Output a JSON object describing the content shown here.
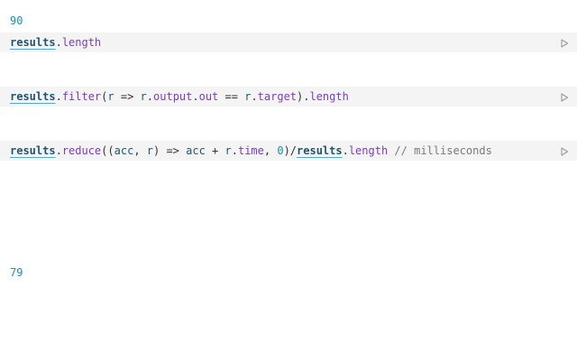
{
  "outputs": {
    "first": "90",
    "second": "79"
  },
  "cells": [
    {
      "tokens": [
        {
          "text": "results",
          "style": "var"
        },
        {
          "text": ".",
          "style": "plain"
        },
        {
          "text": "length",
          "style": "prop"
        }
      ]
    },
    {
      "tokens": [
        {
          "text": "results",
          "style": "var"
        },
        {
          "text": ".",
          "style": "plain"
        },
        {
          "text": "filter",
          "style": "prop"
        },
        {
          "text": "(",
          "style": "plain"
        },
        {
          "text": "r",
          "style": "param"
        },
        {
          "text": " => ",
          "style": "plain"
        },
        {
          "text": "r",
          "style": "param"
        },
        {
          "text": ".",
          "style": "plain"
        },
        {
          "text": "output",
          "style": "prop"
        },
        {
          "text": ".",
          "style": "plain"
        },
        {
          "text": "out",
          "style": "prop"
        },
        {
          "text": " == ",
          "style": "plain"
        },
        {
          "text": "r",
          "style": "param"
        },
        {
          "text": ".",
          "style": "plain"
        },
        {
          "text": "target",
          "style": "prop"
        },
        {
          "text": ").",
          "style": "plain"
        },
        {
          "text": "length",
          "style": "prop"
        }
      ]
    },
    {
      "tokens": [
        {
          "text": "results",
          "style": "var"
        },
        {
          "text": ".",
          "style": "plain"
        },
        {
          "text": "reduce",
          "style": "prop"
        },
        {
          "text": "((",
          "style": "plain"
        },
        {
          "text": "acc",
          "style": "param"
        },
        {
          "text": ", ",
          "style": "plain"
        },
        {
          "text": "r",
          "style": "param"
        },
        {
          "text": ") => ",
          "style": "plain"
        },
        {
          "text": "acc",
          "style": "param"
        },
        {
          "text": " + ",
          "style": "plain"
        },
        {
          "text": "r",
          "style": "param"
        },
        {
          "text": ".",
          "style": "plain"
        },
        {
          "text": "time",
          "style": "prop"
        },
        {
          "text": ", ",
          "style": "plain"
        },
        {
          "text": "0",
          "style": "num"
        },
        {
          "text": ")/",
          "style": "plain"
        },
        {
          "text": "results",
          "style": "var"
        },
        {
          "text": ".",
          "style": "plain"
        },
        {
          "text": "length",
          "style": "prop"
        },
        {
          "text": " ",
          "style": "plain"
        },
        {
          "text": "// milliseconds",
          "style": "comment"
        }
      ]
    }
  ],
  "icons": {
    "run": "play-icon"
  },
  "colors": {
    "cell_background": "#f4f4f4",
    "output": "#1a8fb3",
    "variable": "#1f5672",
    "property": "#7a3fb0",
    "comment": "#7a7a7a",
    "run_icon": "#9a9a9a"
  }
}
